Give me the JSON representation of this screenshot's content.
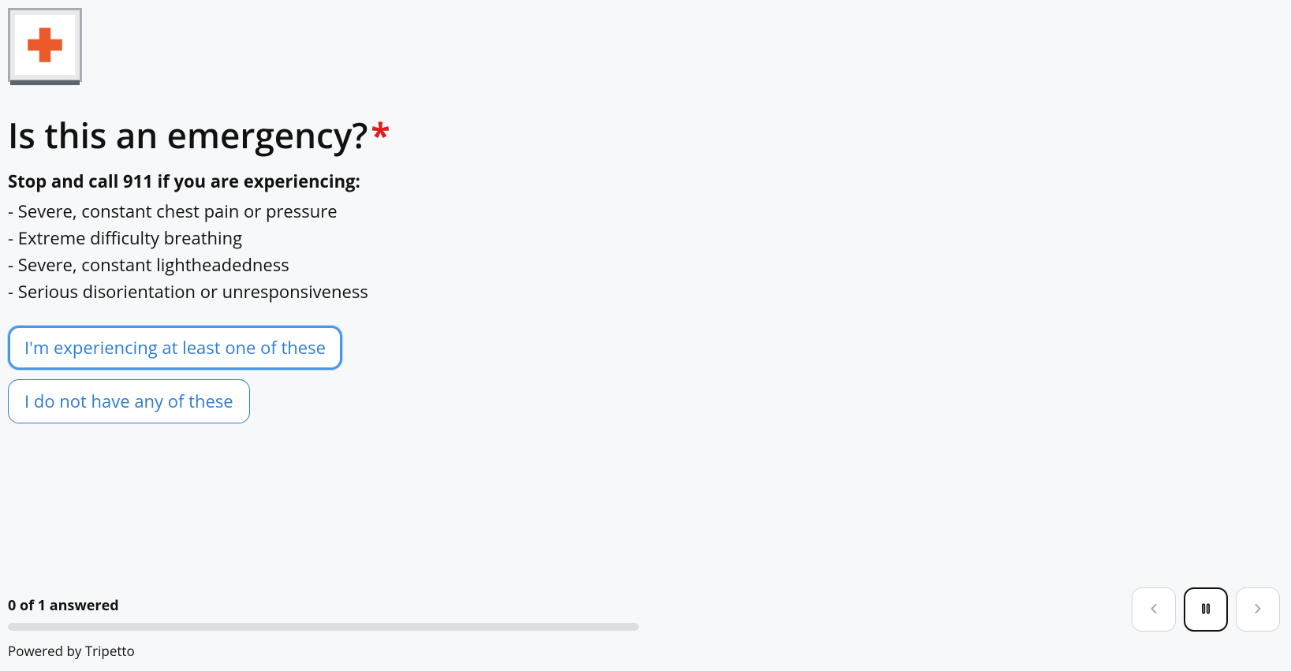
{
  "icon": {
    "name": "medical-cross-icon",
    "color": "#eb5a2a"
  },
  "question": {
    "title": "Is this an emergency?",
    "required_mark": "*",
    "subheading": "Stop and call 911 if you are experiencing:",
    "bullets": [
      "- Severe, constant chest pain or pressure",
      "- Extreme difficulty breathing",
      "- Severe, constant lightheadedness",
      "- Serious disorientation or unresponsiveness"
    ]
  },
  "options": [
    {
      "label": "I'm experiencing at least one of these",
      "focused": true
    },
    {
      "label": "I do not have any of these",
      "focused": false
    }
  ],
  "footer": {
    "progress_text": "0 of 1 answered",
    "powered_by": "Powered by Tripetto"
  },
  "nav": {
    "prev": "previous",
    "pause": "pause",
    "next": "next"
  },
  "colors": {
    "accent": "#2d7dd2",
    "required": "#e21d1d"
  }
}
